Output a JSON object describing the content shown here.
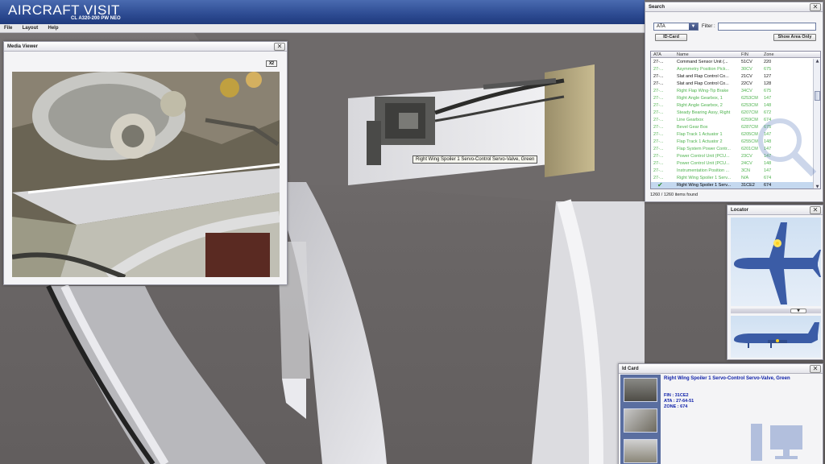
{
  "app": {
    "title": "AIRCRAFT VISIT",
    "subtitle": "CL A320-200 PW NEO",
    "brand_color": "#2d4b92"
  },
  "menu": {
    "items": [
      {
        "label": "File"
      },
      {
        "label": "Layout"
      },
      {
        "label": "Help"
      }
    ]
  },
  "media_viewer": {
    "title": "Media Viewer",
    "zoom_button": "X2",
    "close": "✕"
  },
  "tooltip": {
    "text": "Right Wing Spoiler 1 Servo-Control Servo-Valve, Green"
  },
  "search": {
    "title": "Search",
    "close": "✕",
    "category_select": "ATA",
    "filter_label": "Filter :",
    "filter_value": "",
    "id_card_button": "ID-Card",
    "show_area_button": "Show Area Only",
    "columns": [
      "ATA",
      "Name",
      "FIN",
      "Zone"
    ],
    "rows": [
      {
        "ata": "27-...",
        "name": "Command Sensor Unit (...",
        "fin": "51CV",
        "zone": "220",
        "style": "black"
      },
      {
        "ata": "27-...",
        "name": "Asymmetry Position Pick...",
        "fin": "30CV",
        "zone": "675",
        "style": "green"
      },
      {
        "ata": "27-...",
        "name": "Slat and Flap Control Co...",
        "fin": "21CV",
        "zone": "127",
        "style": "black"
      },
      {
        "ata": "27-...",
        "name": "Slat and Flap Control Co...",
        "fin": "22CV",
        "zone": "128",
        "style": "black"
      },
      {
        "ata": "27-...",
        "name": "Right Flap Wing-Tip Brake",
        "fin": "34CV",
        "zone": "675",
        "style": "green"
      },
      {
        "ata": "27-...",
        "name": "Right Angle Gearbox, 1",
        "fin": "6253CM",
        "zone": "147",
        "style": "green"
      },
      {
        "ata": "27-...",
        "name": "Right Angle Gearbox, 2",
        "fin": "6253CM",
        "zone": "148",
        "style": "green"
      },
      {
        "ata": "27-...",
        "name": "Steady Bearing Assy, Right",
        "fin": "6207CM",
        "zone": "672",
        "style": "green"
      },
      {
        "ata": "27-...",
        "name": "Line Gearbox",
        "fin": "6259CM",
        "zone": "674",
        "style": "green"
      },
      {
        "ata": "27-...",
        "name": "Bevel Gear Box",
        "fin": "6287CM",
        "zone": "675",
        "style": "green"
      },
      {
        "ata": "27-...",
        "name": "Flap Track 1 Actuator 1",
        "fin": "6205CM",
        "zone": "147",
        "style": "green"
      },
      {
        "ata": "27-...",
        "name": "Flap Track 1 Actuator 2",
        "fin": "6255CM",
        "zone": "148",
        "style": "green"
      },
      {
        "ata": "27-...",
        "name": "Flap System Power Contr...",
        "fin": "6201CM",
        "zone": "147",
        "style": "green"
      },
      {
        "ata": "27-...",
        "name": "Power Control Unit (PCU...",
        "fin": "23CV",
        "zone": "147",
        "style": "green"
      },
      {
        "ata": "27-...",
        "name": "Power Control Unit (PCU...",
        "fin": "24CV",
        "zone": "148",
        "style": "green"
      },
      {
        "ata": "27-...",
        "name": "Instrumentation Position ...",
        "fin": "3CN",
        "zone": "147",
        "style": "green"
      },
      {
        "ata": "27-...",
        "name": "Right Wing Spoiler 1 Serv...",
        "fin": "N/A",
        "zone": "674",
        "style": "green"
      },
      {
        "ata": "",
        "name": "Right Wing Spoiler 1 Serv...",
        "fin": "31CE2",
        "zone": "674",
        "style": "selected"
      }
    ],
    "count": "1260 / 1260 items found"
  },
  "locator": {
    "title": "Locator",
    "close": "✕"
  },
  "id_card": {
    "title": "Id Card",
    "close": "✕",
    "name": "Right Wing Spoiler 1 Servo-Control Servo-Valve, Green",
    "fin": "FIN : 31CE2",
    "ata": "ATA : 27-64-51",
    "zone": "ZONE : 674"
  }
}
